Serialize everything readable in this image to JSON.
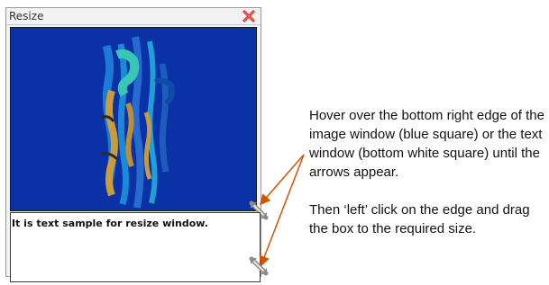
{
  "window": {
    "title": "Resize",
    "close_icon": "close-icon",
    "image_pane": {
      "background": "#0b31a6",
      "artwork": "abstract-graffiti-image"
    },
    "text_pane": {
      "sample_text": "It is text sample for resize window."
    },
    "resize_icon": "diagonal-resize-icon"
  },
  "instructions": {
    "paragraph1": "Hover over the bottom right edge of the image window (blue square) or the text window (bottom white square) until the arrows appear.",
    "paragraph2": "Then ‘left’ click on the edge and drag the box to the required size."
  },
  "colors": {
    "accent_arrow": "#d35400",
    "close_red": "#d11f1f",
    "image_blue": "#0b31a6"
  }
}
